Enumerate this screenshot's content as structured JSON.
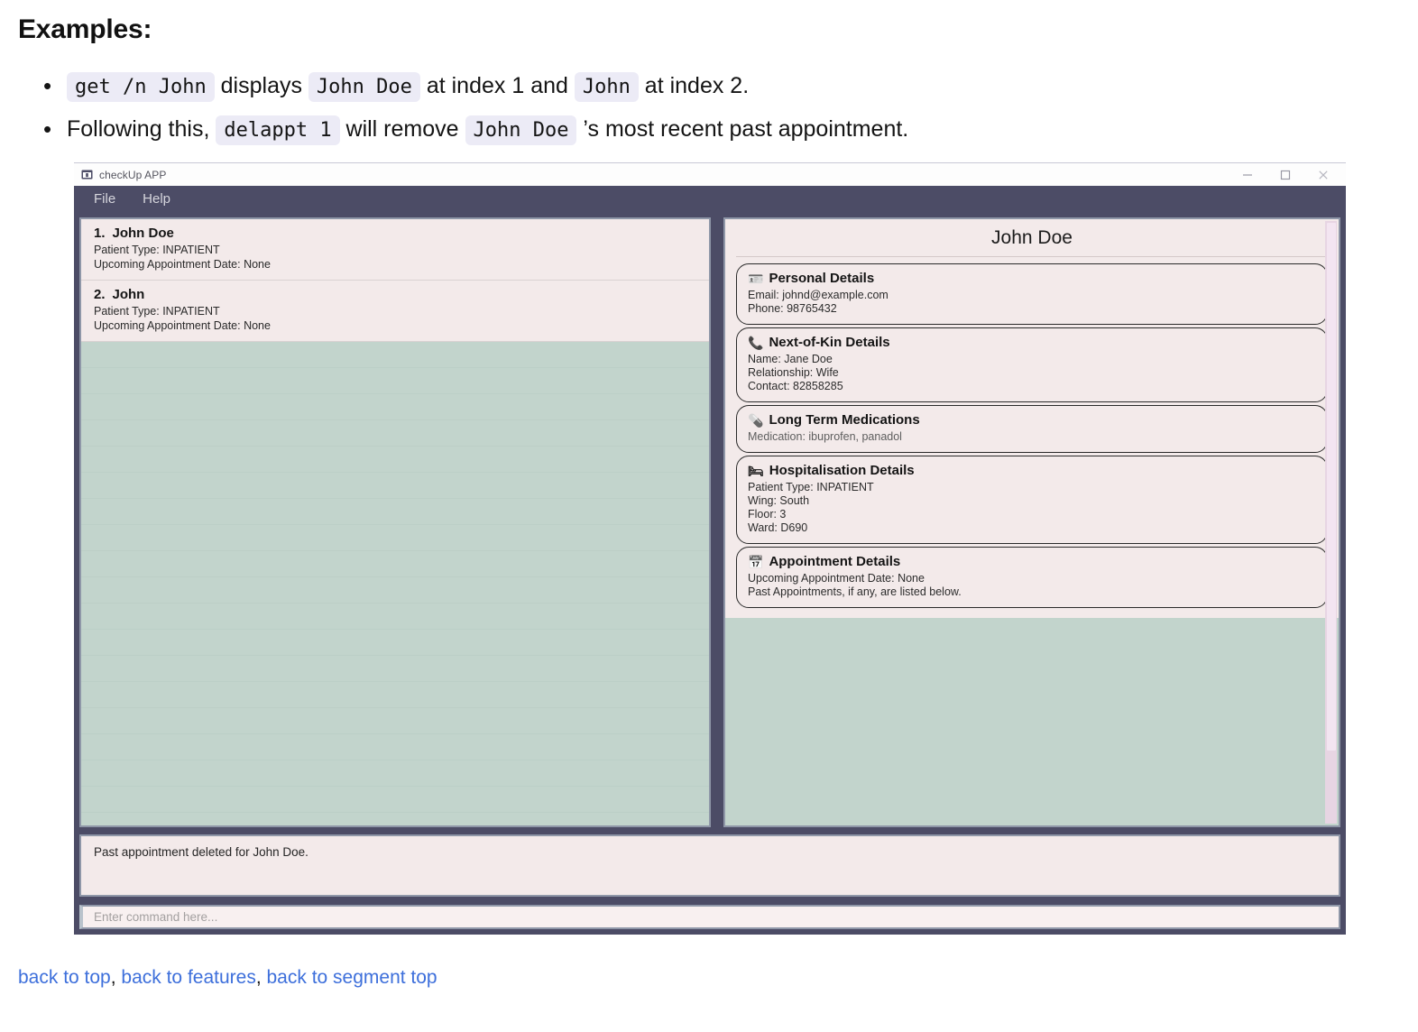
{
  "doc": {
    "heading": "Examples:",
    "bullet1": {
      "code1": "get /n John",
      "text1": " displays ",
      "code2": "John Doe",
      "text2": " at index 1 and ",
      "code3": "John",
      "text3": " at index 2."
    },
    "bullet2": {
      "text0": "Following this, ",
      "code1": "delappt 1",
      "text1": " will remove ",
      "code2": "John Doe",
      "text2": " ’s most recent past appointment."
    }
  },
  "window": {
    "title": "checkUp APP",
    "title_icon": "app-window-icon",
    "controls": {
      "minimize": "minimize-icon",
      "maximize": "maximize-icon",
      "close": "close-icon"
    },
    "menu": [
      {
        "label": "File"
      },
      {
        "label": "Help"
      }
    ]
  },
  "person_list": [
    {
      "index": "1.",
      "name": "John Doe",
      "lines": [
        "Patient Type: INPATIENT",
        "Upcoming Appointment Date: None"
      ]
    },
    {
      "index": "2.",
      "name": "John",
      "lines": [
        "Patient Type: INPATIENT",
        "Upcoming Appointment Date: None"
      ]
    }
  ],
  "detail": {
    "title": "John Doe",
    "cards": [
      {
        "icon": "🪪",
        "icon_name": "id-badge-icon",
        "heading": "Personal Details",
        "lines": [
          "Email: johnd@example.com",
          "Phone: 98765432"
        ],
        "muted": false
      },
      {
        "icon": "📞",
        "icon_name": "phone-icon",
        "heading": "Next-of-Kin Details",
        "lines": [
          "Name: Jane Doe",
          "Relationship: Wife",
          "Contact: 82858285"
        ],
        "muted": false
      },
      {
        "icon": "💊",
        "icon_name": "pill-icon",
        "heading": "Long Term Medications",
        "lines": [
          "Medication: ibuprofen, panadol"
        ],
        "muted": true
      },
      {
        "icon": "🛏",
        "icon_name": "hospital-bed-icon",
        "heading": "Hospitalisation Details",
        "lines": [
          "Patient Type: INPATIENT",
          "Wing: South",
          "Floor: 3",
          "Ward: D690"
        ],
        "muted": false
      },
      {
        "icon": "📅",
        "icon_name": "calendar-icon",
        "heading": "Appointment Details",
        "lines": [
          "Upcoming Appointment Date: None",
          "Past Appointments, if any, are listed below."
        ],
        "muted": false
      }
    ]
  },
  "result": {
    "message": "Past appointment deleted for John Doe."
  },
  "command": {
    "value": "",
    "placeholder": "Enter command here..."
  },
  "footer": {
    "link1": "back to top",
    "sep1": ", ",
    "link2": "back to features",
    "sep2": ", ",
    "link3": "back to segment top"
  },
  "colors": {
    "frame": "#4c4c66",
    "pane_empty": "#c2d4cc",
    "content_bg": "#f3eaea",
    "code_bg": "#ecebf6",
    "link": "#3d6fdb",
    "scrollbar_track": "#e7d5e3"
  }
}
